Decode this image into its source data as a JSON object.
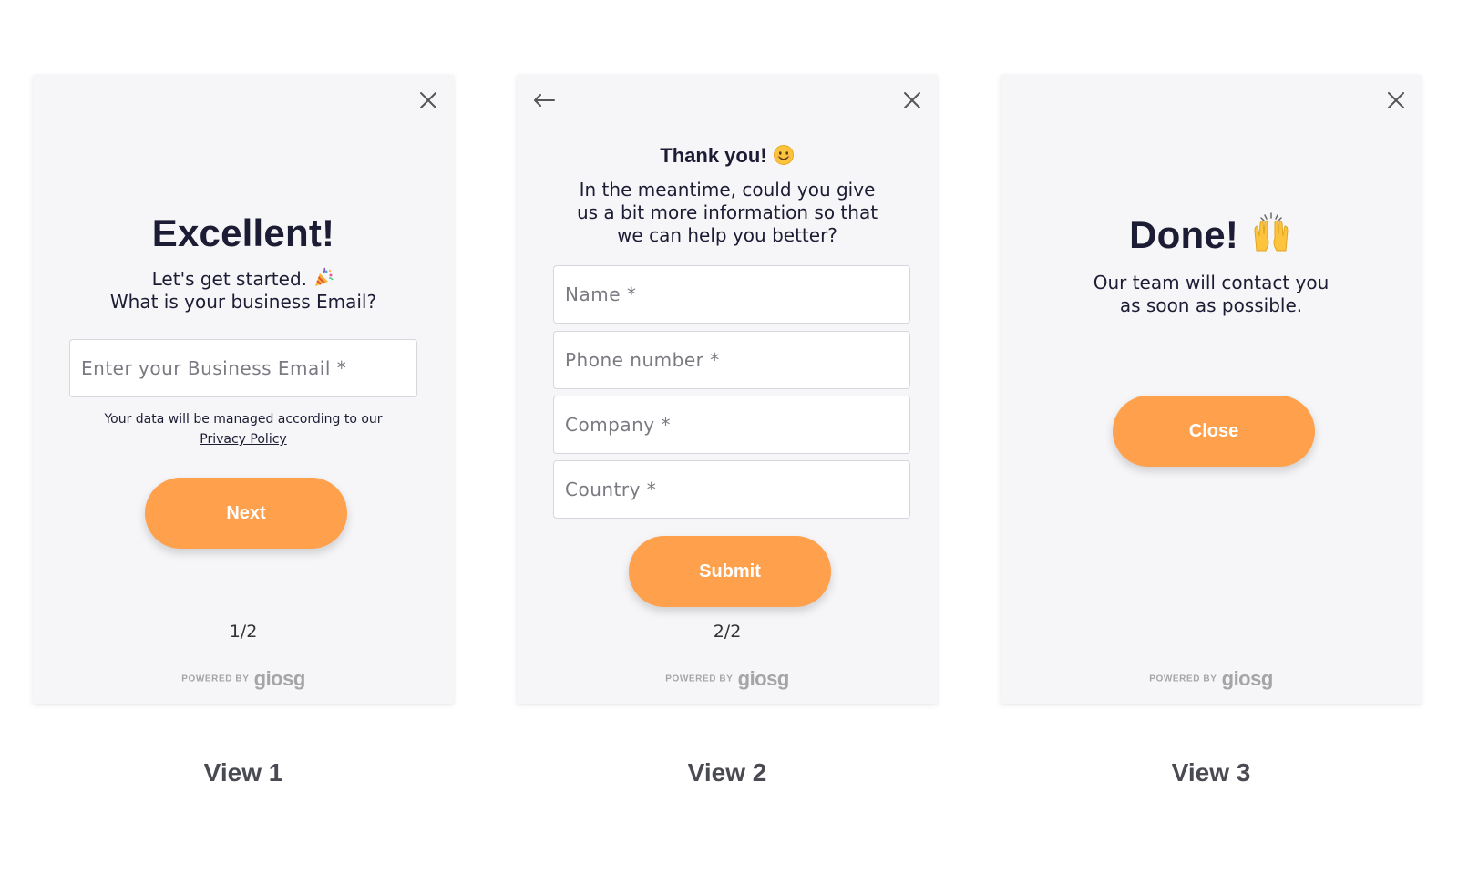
{
  "view1": {
    "title": "Excellent!",
    "subtitle_line1": "Let's get started.",
    "subtitle_line2": "What is your business Email?",
    "email_placeholder": "Enter your Business Email *",
    "privacy_text": "Your data will be managed according to our",
    "privacy_link": "Privacy Policy",
    "next_label": "Next",
    "step": "1/2",
    "powered_by": "POWERED BY",
    "brand": "giosg",
    "party_icon": "party-popper-icon",
    "close_icon": "close-icon"
  },
  "view2": {
    "title": "Thank you!",
    "message_line1": "In the meantime, could you give",
    "message_line2": "us a bit more information so that",
    "message_line3": "we can help you better?",
    "fields": [
      {
        "placeholder": "Name *"
      },
      {
        "placeholder": "Phone number *"
      },
      {
        "placeholder": "Company *"
      },
      {
        "placeholder": "Country *"
      }
    ],
    "submit_label": "Submit",
    "step": "2/2",
    "powered_by": "POWERED BY",
    "brand": "giosg",
    "back_icon": "back-arrow-icon",
    "smile_icon": "smiley-icon"
  },
  "view3": {
    "title": "Done!",
    "message_line1": "Our team will contact you",
    "message_line2": "as soon as possible.",
    "close_label": "Close",
    "powered_by": "POWERED BY",
    "brand": "giosg",
    "hands_icon": "raising-hands-icon"
  },
  "labels": {
    "view1": "View 1",
    "view2": "View 2",
    "view3": "View 3"
  },
  "colors": {
    "accent": "#fea04c",
    "card_bg": "#f6f6f8",
    "text_dark": "#1c1c34",
    "muted": "#a5a5a8"
  }
}
